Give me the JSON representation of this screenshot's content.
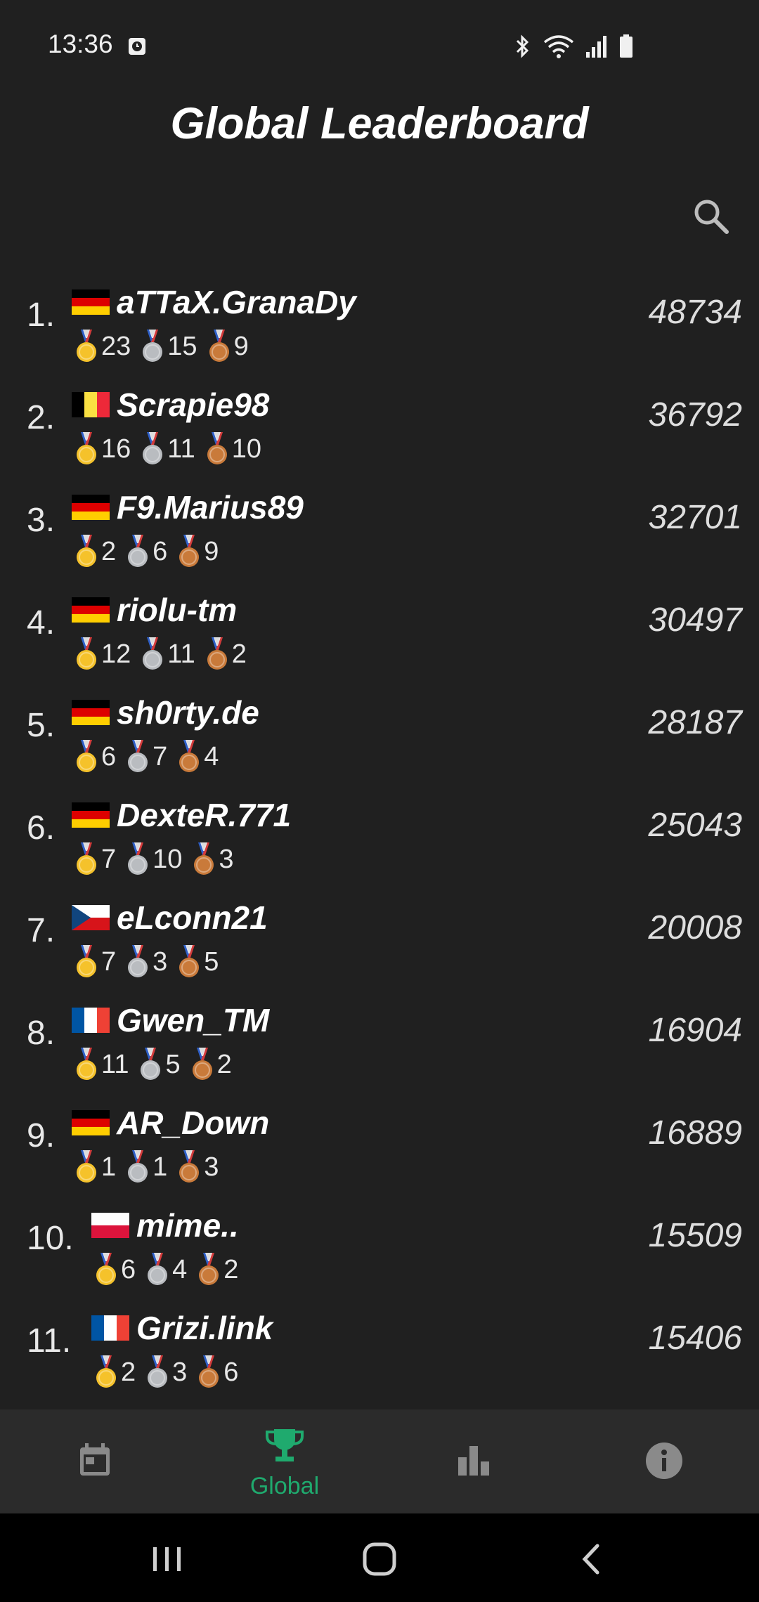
{
  "status_bar": {
    "time": "13:36"
  },
  "header": {
    "title": "Global Leaderboard"
  },
  "icons": {
    "search": "search-icon",
    "clock": "alarm-icon",
    "bluetooth": "bluetooth-icon",
    "wifi": "wifi-icon",
    "signal": "signal-icon",
    "battery": "battery-icon"
  },
  "medal_colors": {
    "gold": "#f5c22b",
    "silver": "#b9bcc0",
    "bronze": "#c97a3a"
  },
  "leaderboard": [
    {
      "rank": "1.",
      "country": "de",
      "name": "aTTaX.GranaDy",
      "gold": "23",
      "silver": "15",
      "bronze": "9",
      "points": "48734"
    },
    {
      "rank": "2.",
      "country": "be",
      "name": "Scrapie98",
      "gold": "16",
      "silver": "11",
      "bronze": "10",
      "points": "36792"
    },
    {
      "rank": "3.",
      "country": "de",
      "name": "F9.Marius89",
      "gold": "2",
      "silver": "6",
      "bronze": "9",
      "points": "32701"
    },
    {
      "rank": "4.",
      "country": "de",
      "name": "riolu-tm",
      "gold": "12",
      "silver": "11",
      "bronze": "2",
      "points": "30497"
    },
    {
      "rank": "5.",
      "country": "de",
      "name": "sh0rty.de",
      "gold": "6",
      "silver": "7",
      "bronze": "4",
      "points": "28187"
    },
    {
      "rank": "6.",
      "country": "de",
      "name": "DexteR.771",
      "gold": "7",
      "silver": "10",
      "bronze": "3",
      "points": "25043"
    },
    {
      "rank": "7.",
      "country": "cz",
      "name": "eLconn21",
      "gold": "7",
      "silver": "3",
      "bronze": "5",
      "points": "20008"
    },
    {
      "rank": "8.",
      "country": "fr",
      "name": "Gwen_TM",
      "gold": "11",
      "silver": "5",
      "bronze": "2",
      "points": "16904"
    },
    {
      "rank": "9.",
      "country": "de",
      "name": "AR_Down",
      "gold": "1",
      "silver": "1",
      "bronze": "3",
      "points": "16889"
    },
    {
      "rank": "10.",
      "country": "pl",
      "name": "mime..",
      "gold": "6",
      "silver": "4",
      "bronze": "2",
      "points": "15509"
    },
    {
      "rank": "11.",
      "country": "fr",
      "name": "Grizi.link",
      "gold": "2",
      "silver": "3",
      "bronze": "6",
      "points": "15406"
    }
  ],
  "bottom_nav": [
    {
      "icon": "calendar-icon",
      "label": "",
      "active": false
    },
    {
      "icon": "trophy-icon",
      "label": "Global",
      "active": true
    },
    {
      "icon": "bar-chart-icon",
      "label": "",
      "active": false
    },
    {
      "icon": "info-icon",
      "label": "",
      "active": false
    }
  ],
  "accent_color": "#1faa6e"
}
